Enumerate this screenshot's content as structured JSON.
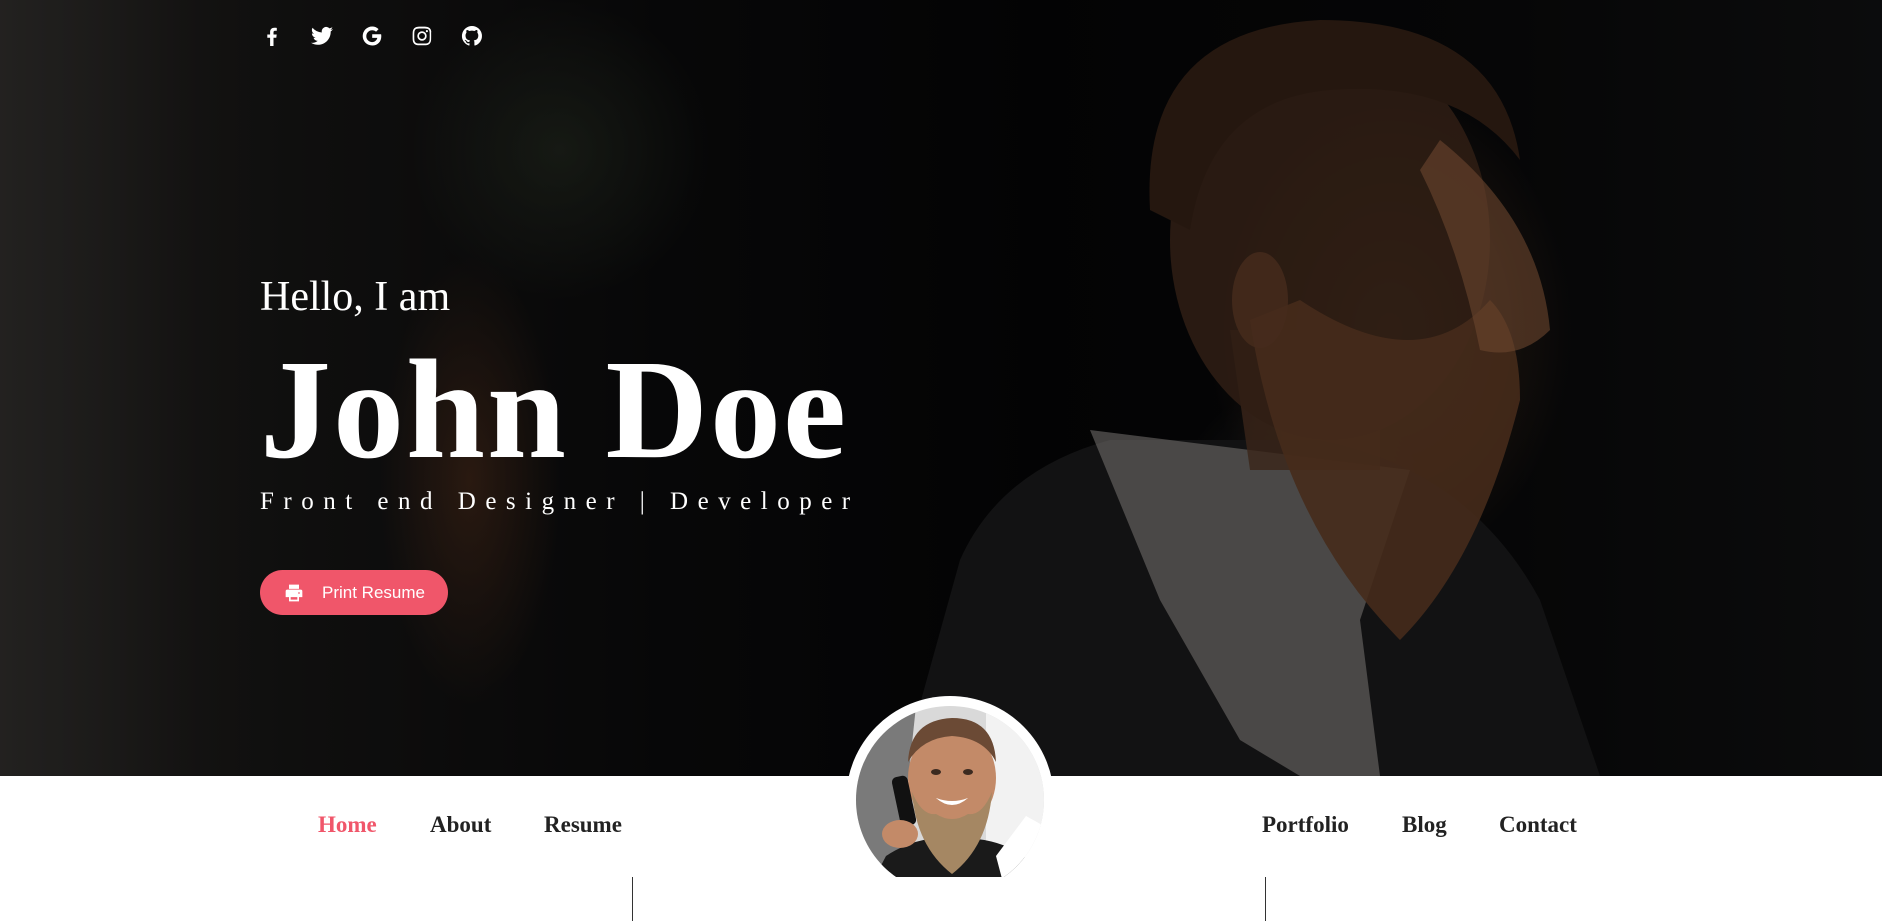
{
  "social": [
    {
      "name": "facebook-icon"
    },
    {
      "name": "twitter-icon"
    },
    {
      "name": "google-icon"
    },
    {
      "name": "instagram-icon"
    },
    {
      "name": "github-icon"
    }
  ],
  "hero": {
    "greeting": "Hello, I am",
    "name": "John Doe",
    "role": "Front end Designer | Developer",
    "print_button": "Print Resume"
  },
  "nav": {
    "left": [
      "Home",
      "About",
      "Resume"
    ],
    "right": [
      "Portfolio",
      "Blog",
      "Contact"
    ],
    "active": "Home"
  },
  "colors": {
    "accent": "#f0566a",
    "nav_text": "#222222",
    "hero_text": "#ffffff"
  }
}
